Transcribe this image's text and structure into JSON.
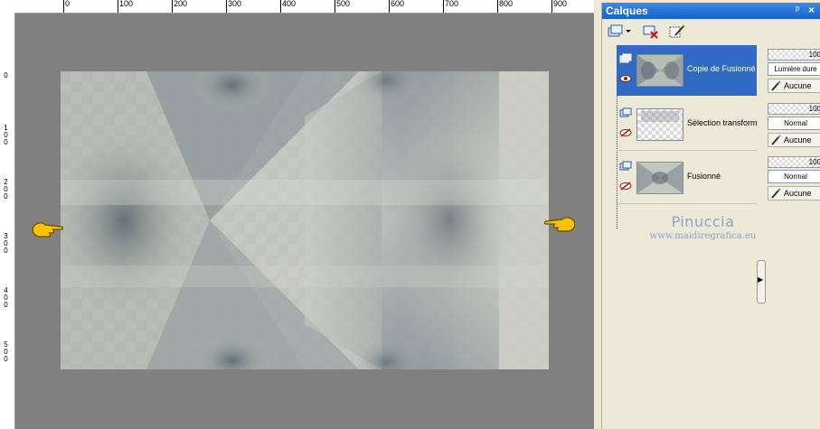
{
  "rulers": {
    "horizontal": [
      "0",
      "100",
      "200",
      "300",
      "400",
      "500",
      "600",
      "700",
      "800",
      "900"
    ],
    "vertical": [
      "0",
      "100",
      "200",
      "300",
      "400",
      "500"
    ]
  },
  "layers_palette": {
    "title": "Calques",
    "pin_glyph": "ᵖ",
    "close_glyph": "×",
    "toolbar": [
      "new-layer-icon",
      "delete-layer-icon",
      "layer-properties-icon"
    ],
    "layers": [
      {
        "name": "Copie de Fusionné",
        "selected": true,
        "visible": true,
        "thumb_transparent": false,
        "opacity": "100",
        "blend_mode": "Lumière dure",
        "lock": "Aucune"
      },
      {
        "name": "Sélection transform",
        "selected": false,
        "visible": false,
        "thumb_transparent": true,
        "opacity": "100",
        "blend_mode": "Normal",
        "lock": "Aucune"
      },
      {
        "name": "Fusionné",
        "selected": false,
        "visible": false,
        "thumb_transparent": false,
        "opacity": "100",
        "blend_mode": "Normal",
        "lock": "Aucune"
      }
    ]
  },
  "watermark": {
    "name": "Pinuccia",
    "url": "www.maidiregrafica.eu"
  },
  "colors": {
    "workspace": "#808080",
    "selection": "#316ac5",
    "titlebar": "#1c5fc7",
    "watermark": "#8aa3c8"
  },
  "icons": {
    "left_pointer": "pointing-hand-icon",
    "right_pointer": "pointing-hand-icon"
  }
}
